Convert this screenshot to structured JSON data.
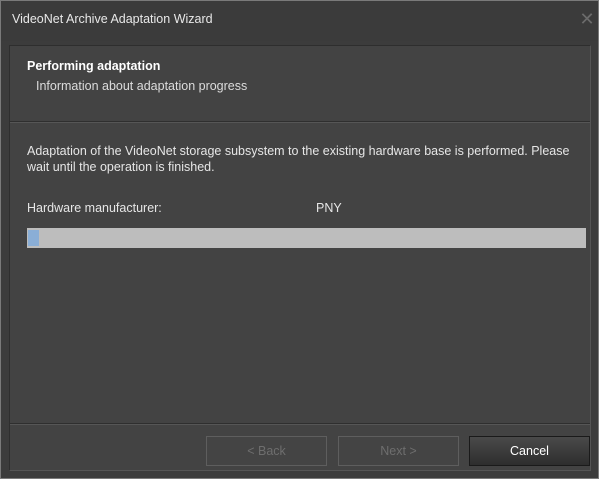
{
  "window": {
    "title": "VideoNet Archive Adaptation Wizard",
    "close_glyph": "✕"
  },
  "header": {
    "title": "Performing adaptation",
    "subtitle": "Information about adaptation progress"
  },
  "body": {
    "description": "Adaptation of the VideoNet storage subsystem to the existing hardware base is performed. Please wait until the operation is finished.",
    "hardware_label": "Hardware manufacturer:",
    "hardware_value": "PNY",
    "progress_percent": 2
  },
  "buttons": {
    "back": "< Back",
    "next": "Next >",
    "cancel": "Cancel"
  },
  "colors": {
    "background": "#3c3c3c",
    "progress_fill": "#8aaed6",
    "progress_track": "#bdbdbd"
  }
}
